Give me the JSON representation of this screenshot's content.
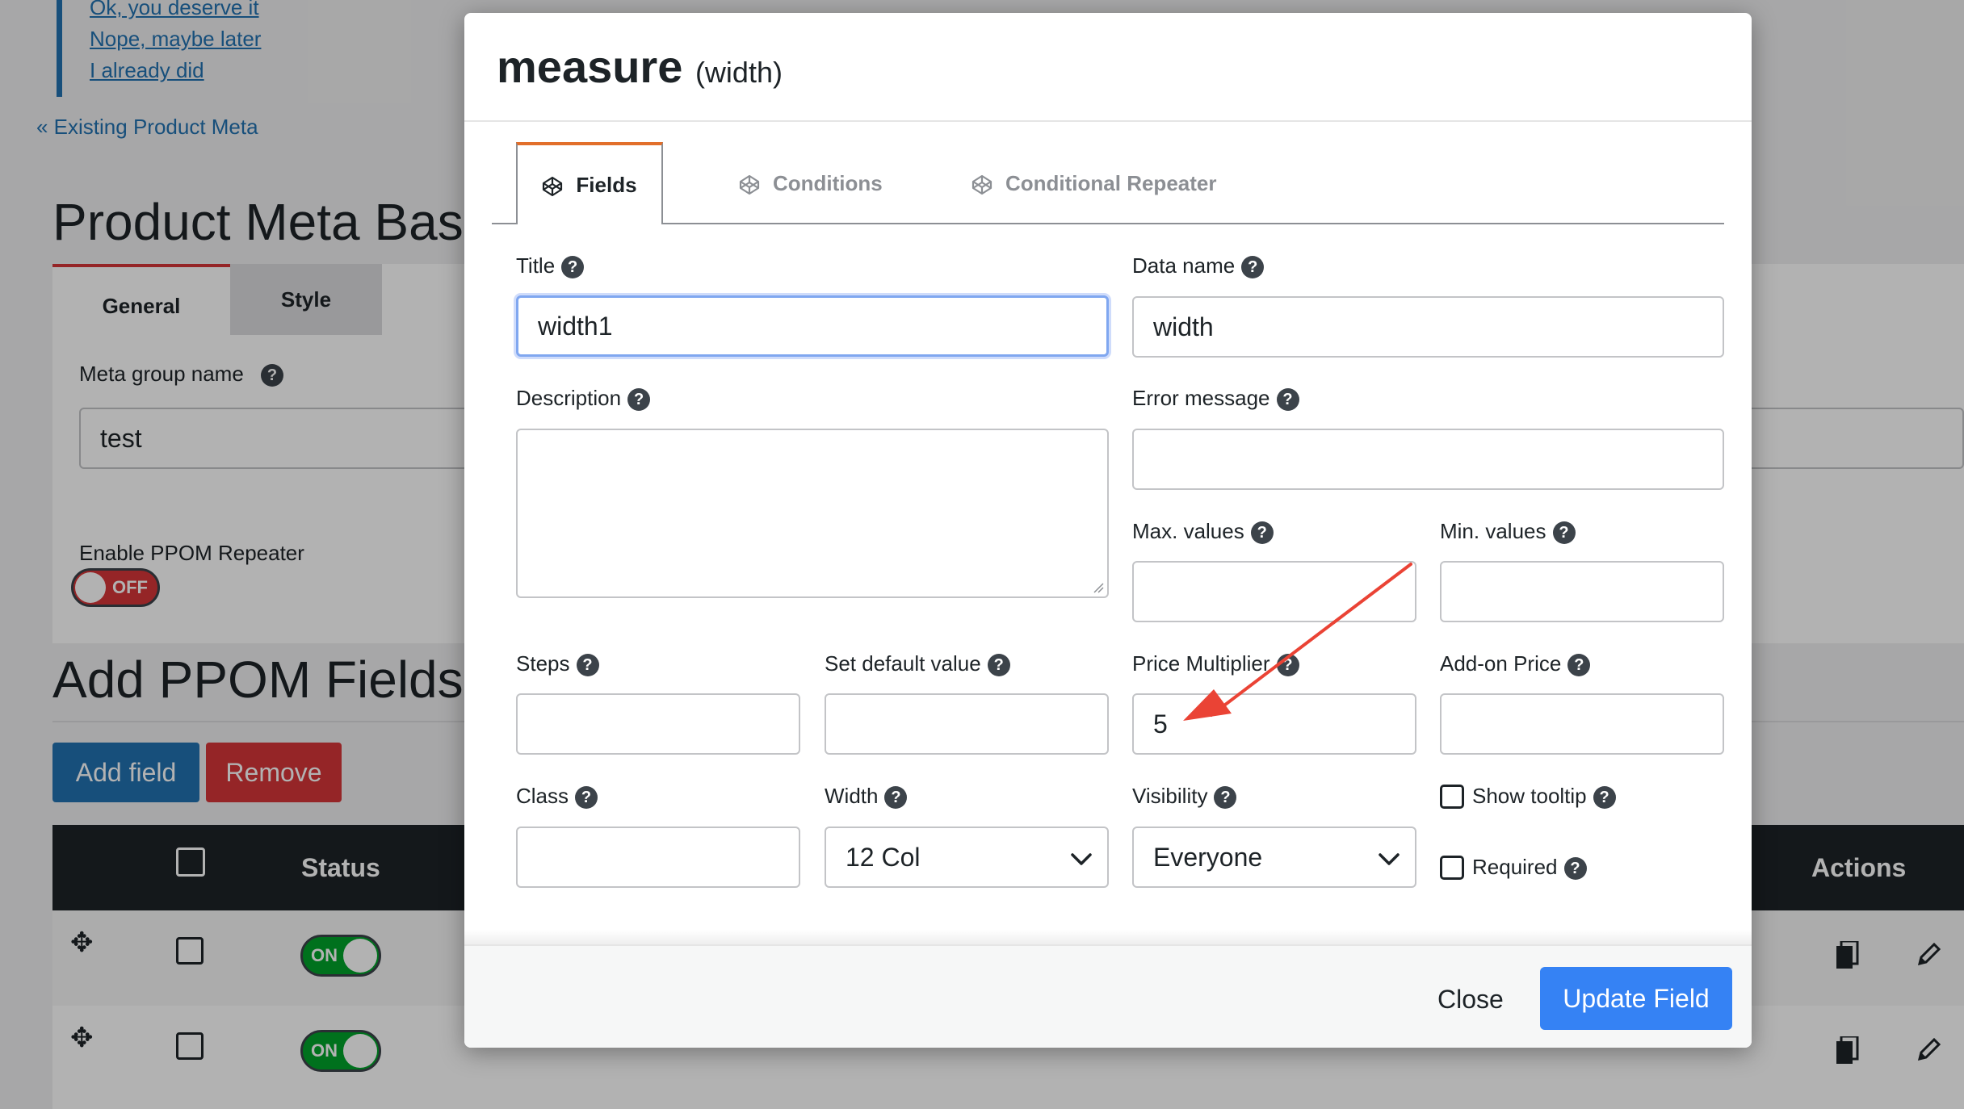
{
  "background": {
    "notice_links": [
      "Ok, you deserve it",
      "Nope, maybe later",
      "I already did"
    ],
    "back_link": "« Existing Product Meta",
    "page_title": "Product Meta Basi",
    "tabs": [
      "General",
      "Style"
    ],
    "meta_group_label": "Meta group name",
    "meta_group_value": "test",
    "repeater_label": "Enable PPOM Repeater",
    "repeater_toggle": "OFF",
    "add_fields_title": "Add PPOM Fields",
    "add_button": "Add field",
    "remove_button": "Remove",
    "table_headers": {
      "status": "Status",
      "actions": "Actions"
    },
    "rows": [
      {
        "status": "ON"
      },
      {
        "status": "ON"
      }
    ]
  },
  "modal": {
    "title": "measure",
    "subtitle": "(width)",
    "tabs": [
      "Fields",
      "Conditions",
      "Conditional Repeater"
    ],
    "fields": {
      "title_label": "Title",
      "title_value": "width1",
      "data_name_label": "Data name",
      "data_name_value": "width",
      "description_label": "Description",
      "error_message_label": "Error message",
      "max_values_label": "Max. values",
      "min_values_label": "Min. values",
      "steps_label": "Steps",
      "default_value_label": "Set default value",
      "price_multiplier_label": "Price Multiplier",
      "price_multiplier_value": "5",
      "addon_price_label": "Add-on Price",
      "class_label": "Class",
      "width_label": "Width",
      "width_value": "12 Col",
      "visibility_label": "Visibility",
      "visibility_value": "Everyone",
      "show_tooltip_label": "Show tooltip",
      "required_label": "Required"
    },
    "help_glyph": "?",
    "close_button": "Close",
    "update_button": "Update Field"
  },
  "colors": {
    "primary": "#3582f4",
    "wp_blue": "#2271b1",
    "danger": "#d63638",
    "success": "#00a32a",
    "annotation_arrow": "#ea4335",
    "active_tab_accent": "#e26f2b"
  }
}
